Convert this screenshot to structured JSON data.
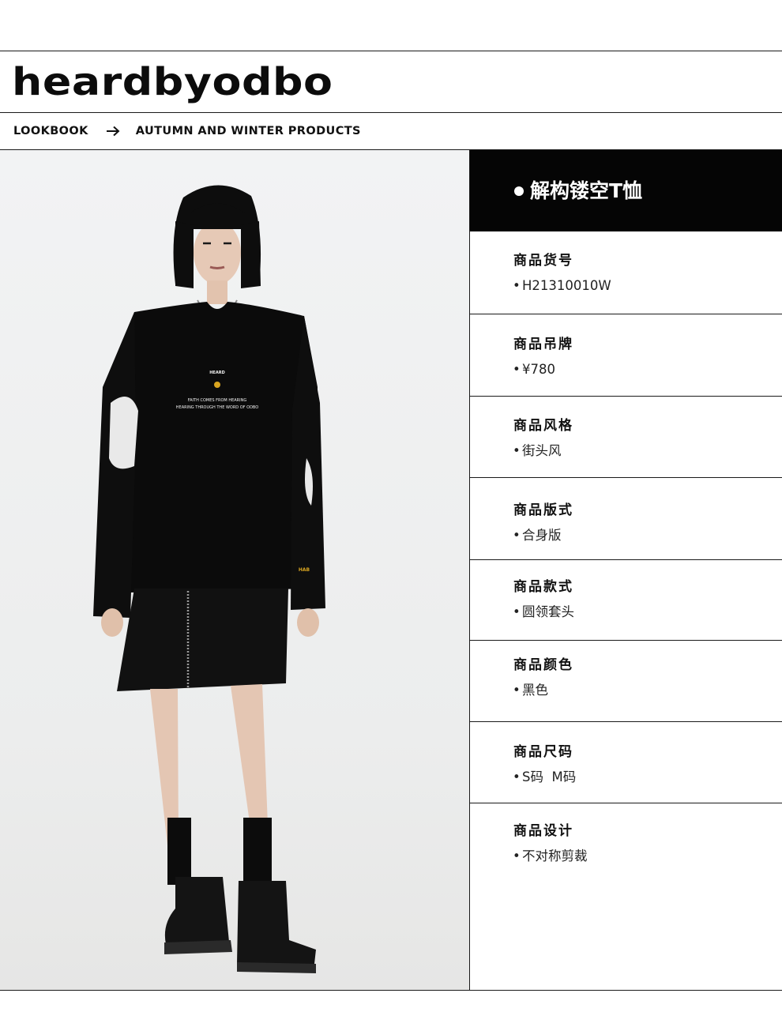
{
  "brand": {
    "logo_text": "heardbyodbo"
  },
  "breadcrumb": {
    "first": "LOOKBOOK",
    "second": "AUTUMN AND WINTER PRODUCTS"
  },
  "product": {
    "title": "解构镂空T恤",
    "specs": [
      {
        "label": "商品货号",
        "value": "H21310010W"
      },
      {
        "label": "商品吊牌",
        "value": "¥780"
      },
      {
        "label": "商品风格",
        "value": "街头风"
      },
      {
        "label": "商品版式",
        "value": "合身版"
      },
      {
        "label": "商品款式",
        "value": "圆领套头"
      },
      {
        "label": "商品颜色",
        "value": "黑色"
      },
      {
        "label": "商品尺码",
        "value": "S码  M码"
      },
      {
        "label": "商品设计",
        "value": "不对称剪裁"
      }
    ]
  },
  "garment_print": {
    "brand_mark": "HEARD",
    "line1": "FAITH COMES FROM HEARING",
    "line2": "HEARING THROUGH THE WORD OF ODBO",
    "sleeve_mark": "HAB"
  },
  "colors": {
    "title_bg": "#050505",
    "rule": "#1a1a1a",
    "photo_bg": "#eceded"
  }
}
